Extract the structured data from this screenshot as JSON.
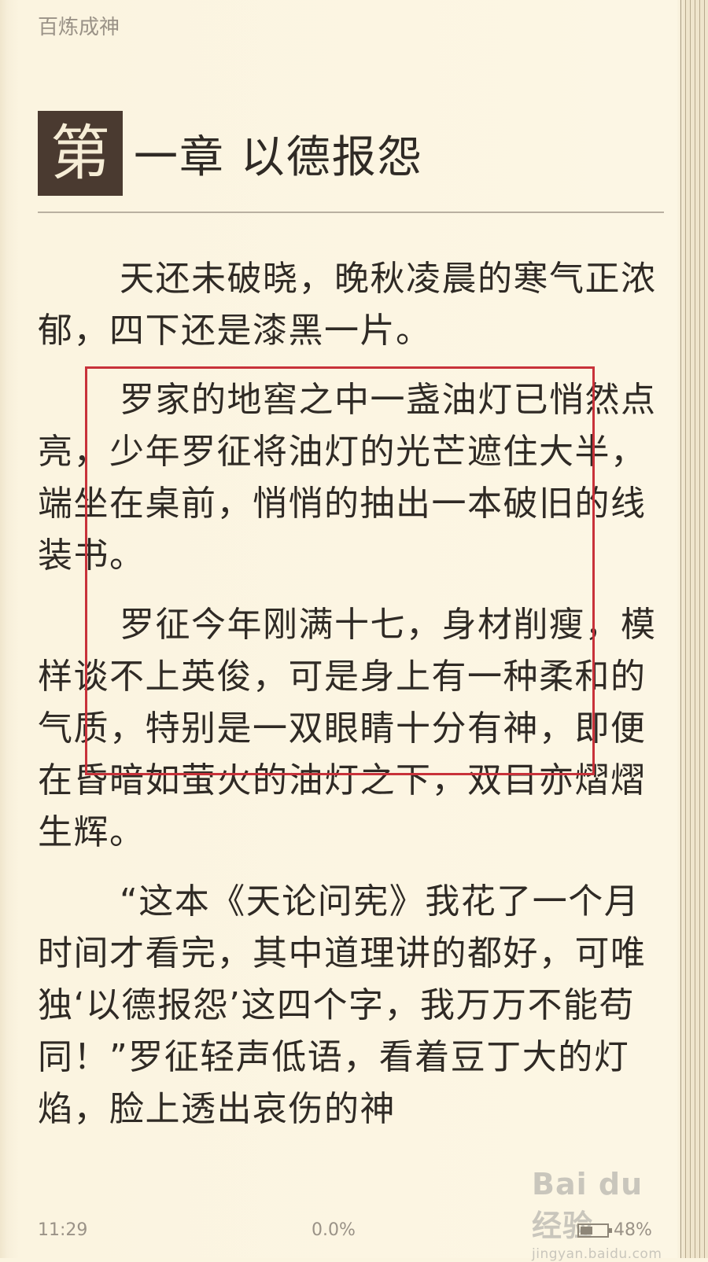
{
  "book": {
    "title": "百炼成神"
  },
  "chapter": {
    "first_char": "第",
    "rest": "一章 以德报怨"
  },
  "paragraphs": [
    "天还未破晓，晚秋凌晨的寒气正浓郁，四下还是漆黑一片。",
    "罗家的地窖之中一盏油灯已悄然点亮，少年罗征将油灯的光芒遮住大半，端坐在桌前，悄悄的抽出一本破旧的线装书。",
    "罗征今年刚满十七，身材削瘦，模样谈不上英俊，可是身上有一种柔和的气质，特别是一双眼睛十分有神，即便在昏暗如萤火的油灯之下，双目亦熠熠生辉。",
    "“这本《天论问宪》我花了一个月时间才看完，其中道理讲的都好，可唯独‘以德报怨’这四个字，我万万不能苟同！”罗征轻声低语，看着豆丁大的灯焰，脸上透出哀伤的神"
  ],
  "footer": {
    "time": "11:29",
    "progress": "0.0%",
    "battery": "48%",
    "battery_level": 0.48
  },
  "watermark": {
    "main": "Bai du 经验",
    "sub": "jingyan.baidu.com"
  },
  "colors": {
    "page_bg": "#fbf4e0",
    "chapter_badge": "#4a3a30",
    "highlight_border": "#c8323a",
    "meta_text": "#9a9287"
  }
}
